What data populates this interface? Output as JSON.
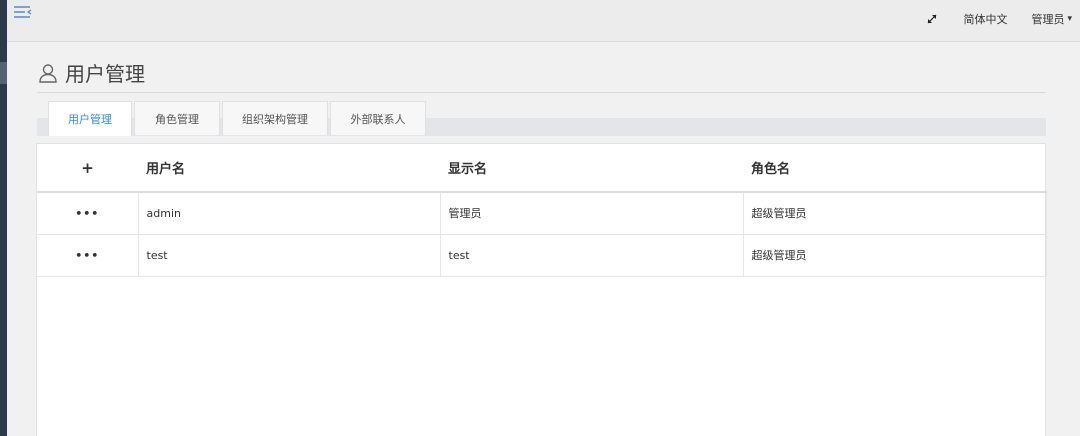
{
  "topbar": {
    "language": "简体中文",
    "user_menu": "管理员",
    "user_menu_caret": "▾"
  },
  "page": {
    "title": "用户管理"
  },
  "tabs": [
    {
      "label": "用户管理",
      "active": true
    },
    {
      "label": "角色管理",
      "active": false
    },
    {
      "label": "组织架构管理",
      "active": false
    },
    {
      "label": "外部联系人",
      "active": false
    }
  ],
  "table": {
    "add_symbol": "+",
    "columns": [
      "用户名",
      "显示名",
      "角色名"
    ],
    "rows": [
      {
        "actions": "•••",
        "username": "admin",
        "display_name": "管理员",
        "role": "超级管理员"
      },
      {
        "actions": "•••",
        "username": "test",
        "display_name": "test",
        "role": "超级管理员"
      }
    ]
  },
  "colors": {
    "accent": "#3b8bd8",
    "sidebar": "#2d3a4b",
    "topbar": "#ececec"
  },
  "icons": {
    "menu_toggle": "menu-toggle-icon",
    "fullscreen": "expand-icon",
    "user": "user-icon"
  }
}
